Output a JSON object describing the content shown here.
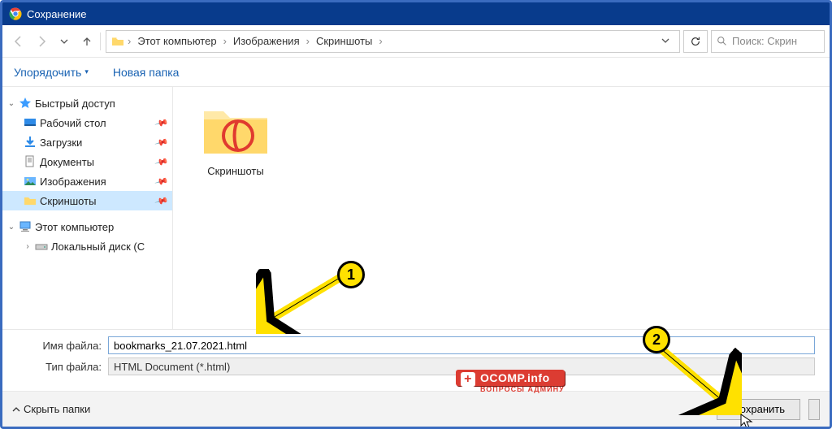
{
  "title": "Сохранение",
  "nav": {
    "crumbs": [
      "Этот компьютер",
      "Изображения",
      "Скриншоты"
    ],
    "search_placeholder": "Поиск: Скрин"
  },
  "toolbar": {
    "organize": "Упорядочить",
    "new_folder": "Новая папка"
  },
  "sidebar": {
    "quick_access": "Быстрый доступ",
    "items": [
      {
        "label": "Рабочий стол"
      },
      {
        "label": "Загрузки"
      },
      {
        "label": "Документы"
      },
      {
        "label": "Изображения"
      },
      {
        "label": "Скриншоты"
      }
    ],
    "this_pc": "Этот компьютер",
    "local_disk": "Локальный диск (C"
  },
  "content": {
    "folder_name": "Скриншоты"
  },
  "fields": {
    "filename_label": "Имя файла:",
    "filename_value": "bookmarks_21.07.2021.html",
    "type_label": "Тип файла:",
    "type_value": "HTML Document (*.html)"
  },
  "footer": {
    "hide_folders": "Скрыть папки",
    "save": "Сохранить"
  },
  "annotations": {
    "badge1": "1",
    "badge2": "2"
  },
  "watermark": {
    "main": "OCOMP.info",
    "sub": "ВОПРОСЫ АДМИНУ"
  }
}
